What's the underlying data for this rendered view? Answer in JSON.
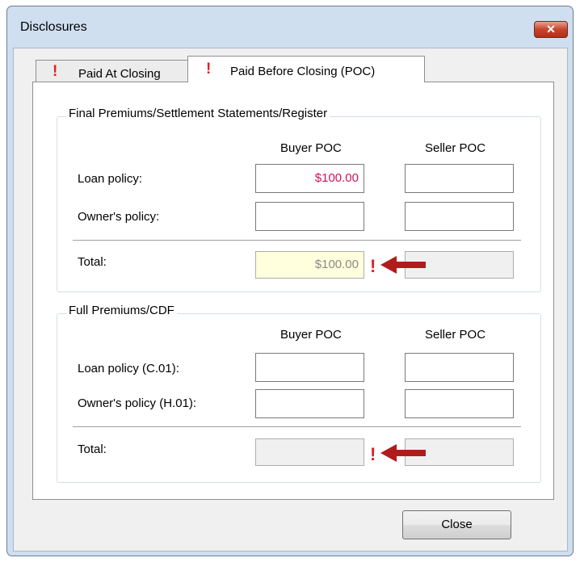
{
  "window": {
    "title": "Disclosures",
    "close_glyph": "✕"
  },
  "tabs": [
    {
      "label": "Paid At Closing",
      "warning": "!"
    },
    {
      "label": "Paid Before Closing (POC)",
      "warning": "!"
    }
  ],
  "group1": {
    "title": "Final Premiums/Settlement Statements/Register",
    "buyer_header": "Buyer POC",
    "seller_header": "Seller POC",
    "rows": [
      {
        "label": "Loan policy:",
        "buyer": "$100.00",
        "seller": ""
      },
      {
        "label": "Owner's policy:",
        "buyer": "",
        "seller": ""
      }
    ],
    "total": {
      "label": "Total:",
      "buyer": "$100.00",
      "seller": ""
    },
    "warning": "!"
  },
  "group2": {
    "title": "Full Premiums/CDF",
    "buyer_header": "Buyer POC",
    "seller_header": "Seller POC",
    "rows": [
      {
        "label": "Loan policy (C.01):",
        "buyer": "",
        "seller": ""
      },
      {
        "label": "Owner's policy (H.01):",
        "buyer": "",
        "seller": ""
      }
    ],
    "total": {
      "label": "Total:",
      "buyer": "",
      "seller": ""
    },
    "warning": "!"
  },
  "buttons": {
    "close": "Close"
  },
  "colors": {
    "warning": "#e31e24",
    "arrow": "#b01c1c",
    "value_pink": "#d3105a",
    "total_highlight": "#ffffdd"
  }
}
